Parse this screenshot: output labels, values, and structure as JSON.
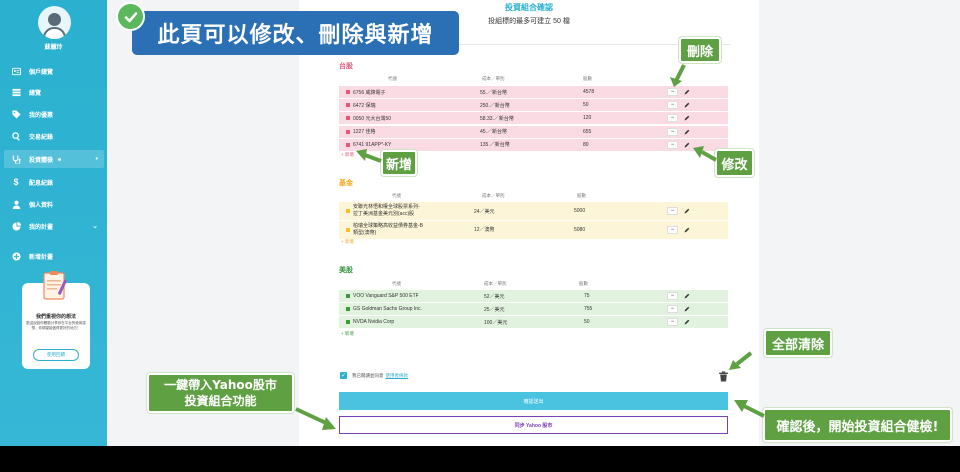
{
  "sidebar": {
    "user_name": "蘇麗玲",
    "items": [
      {
        "label": "個戶總覽",
        "icon": "id-card-icon"
      },
      {
        "label": "總覽",
        "icon": "table-icon"
      },
      {
        "label": "我的優惠",
        "icon": "tag-icon"
      },
      {
        "label": "交易紀錄",
        "icon": "search-icon"
      },
      {
        "label": "投資體檢",
        "icon": "stethoscope-icon"
      },
      {
        "label": "配息紀錄",
        "icon": "dollar-icon"
      },
      {
        "label": "個人資料",
        "icon": "user-icon"
      },
      {
        "label": "我的計畫",
        "icon": "pie-chart-icon"
      },
      {
        "label": "新增計畫",
        "icon": "plus-circle-icon"
      }
    ],
    "feedback": {
      "title": "我們重視你的想法",
      "desc": "歡迎說說你體驗分享你在平台的使用感想，你期望能做得更好的地方！",
      "button": "使用回饋"
    }
  },
  "panel": {
    "title": "投資組合確認",
    "subtitle": "投組標的最多可建立 50 檔"
  },
  "columns": {
    "code": "代號",
    "cost": "成本／單別",
    "shares": "股數"
  },
  "sections": {
    "tw": {
      "title": "台股",
      "color": "#e05a7a",
      "add_label": "+ 新增",
      "rows": [
        {
          "name": "6756 威鋒電子",
          "cost": "55.／新台幣",
          "shares": "4578"
        },
        {
          "name": "6472 保瑞",
          "cost": "250.／新台幣",
          "shares": "50"
        },
        {
          "name": "0050 元大台灣50",
          "cost": "58.33.／新台幣",
          "shares": "120"
        },
        {
          "name": "1227 佳格",
          "cost": "45.／新台幣",
          "shares": "655"
        },
        {
          "name": "6741 91APP*-KY",
          "cost": "135.／新台幣",
          "shares": "80"
        }
      ]
    },
    "fund": {
      "title": "基金",
      "color": "#f2a81d",
      "add_label": "+ 新增",
      "rows": [
        {
          "name": "安聯光林悟和權全球股票系列-",
          "name2": "拉丁美洲基金美元別(acc)股",
          "cost": "24／美元",
          "shares": "5000"
        },
        {
          "name": "柏瑞全球策略高收益債券基金-B",
          "name2": "類型(澳幣)",
          "cost": "12／澳幣",
          "shares": "5080"
        }
      ]
    },
    "us": {
      "title": "美股",
      "color": "#3a9a3e",
      "add_label": "+ 新增",
      "rows": [
        {
          "name": "VOO Vanguard S&P 500 ETF",
          "cost": "52／美元",
          "shares": "75"
        },
        {
          "name": "GS Goldman Sachs Group Inc.",
          "cost": "25／美元",
          "shares": "755"
        },
        {
          "name": "NVDA Nvidia Corp",
          "cost": "100／美元",
          "shares": "50"
        }
      ]
    }
  },
  "agree": {
    "text": "我已閱讀並同意",
    "link": "使用者條款"
  },
  "buttons": {
    "confirm": "確認送出",
    "yahoo": "同步 Yahoo 股市"
  },
  "callouts": {
    "banner": "此頁可以修改、刪除與新增",
    "delete": "刪除",
    "add": "新增",
    "edit": "修改",
    "clear_all": "全部清除",
    "yahoo_line1": "一鍵帶入Yahoo股市",
    "yahoo_line2": "投資組合功能",
    "confirm_tip": "確認後，開始投資組合健檢!"
  }
}
